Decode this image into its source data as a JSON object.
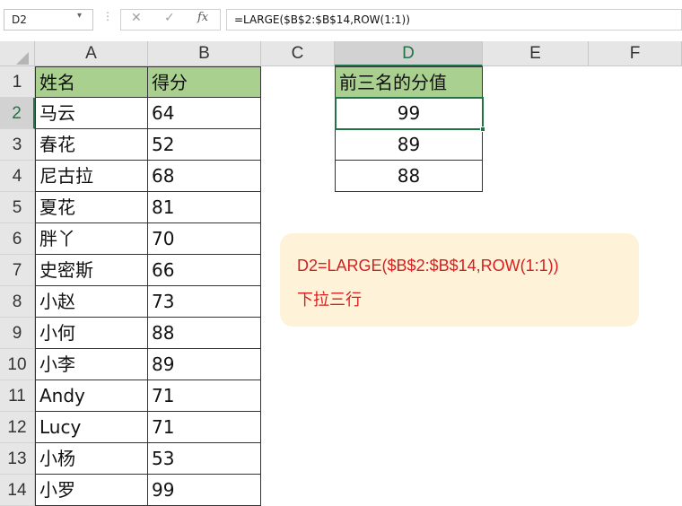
{
  "name_box": "D2",
  "formula_bar": {
    "cancel_icon": "✕",
    "enter_icon": "✓",
    "fx_label": "fx",
    "formula": "=LARGE($B$2:$B$14,ROW(1:1))"
  },
  "columns": [
    "A",
    "B",
    "C",
    "D",
    "E",
    "F"
  ],
  "rows": [
    "1",
    "2",
    "3",
    "4",
    "5",
    "6",
    "7",
    "8",
    "9",
    "10",
    "11",
    "12",
    "13",
    "14"
  ],
  "table": {
    "header": [
      "姓名",
      "得分"
    ],
    "names": [
      "马云",
      "春花",
      "尼古拉",
      "夏花",
      "胖丫",
      "史密斯",
      "小赵",
      "小何",
      "小李",
      "Andy",
      "Lucy",
      "小杨",
      "小罗"
    ],
    "scores": [
      "64",
      "52",
      "68",
      "81",
      "70",
      "66",
      "73",
      "88",
      "89",
      "71",
      "71",
      "53",
      "99"
    ]
  },
  "result": {
    "header": "前三名的分值",
    "values": [
      "99",
      "89",
      "88"
    ]
  },
  "note": {
    "line1": "D2=LARGE($B$2:$B$14,ROW(1:1))",
    "line2": "下拉三行"
  },
  "colors": {
    "header_fill": "#a9d08e",
    "accent": "#217346",
    "note_bg": "#fef2d8",
    "note_text": "#d62020"
  }
}
